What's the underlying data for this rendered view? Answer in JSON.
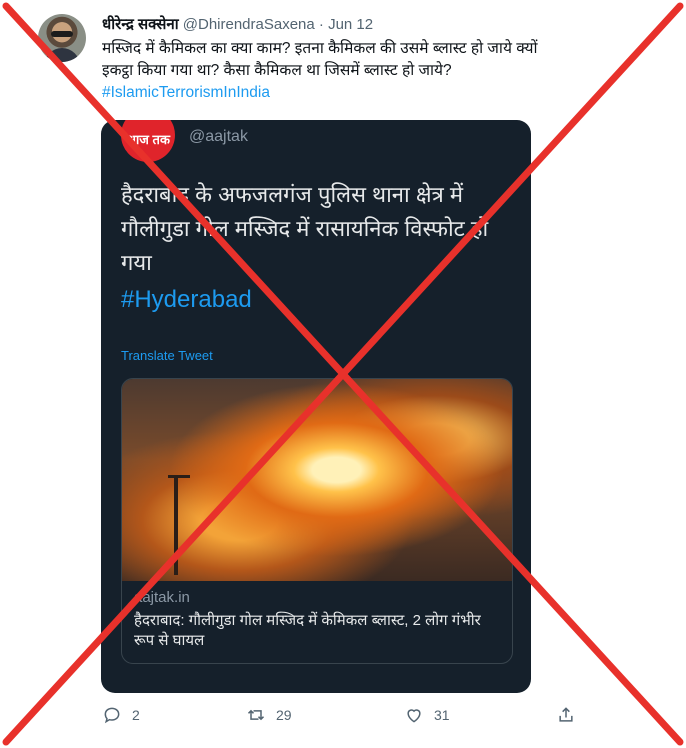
{
  "tweet": {
    "author_name": "धीरेन्द्र सक्सेना",
    "handle": "@DhirendraSaxena",
    "separator": "·",
    "date": "Jun 12",
    "text_line1": "मस्जिद में कैमिकल का क्या काम? इतना कैमिकल की उसमे ब्लास्ट हो जाये क्यों",
    "text_line2": "इकट्ठा किया गया था? कैसा कैमिकल था जिसमें ब्लास्ट हो जाये?",
    "hashtag": "#IslamicTerrorismInIndia"
  },
  "quoted": {
    "logo_text": "आज तक",
    "handle": "@aajtak",
    "text": "हैदराबाद के अफजलगंज पुलिस थाना क्षेत्र में गौलीगुडा गोल मस्जिद में रासायनिक विस्फोट हो गया",
    "hashtag": "#Hyderabad",
    "translate": "Translate Tweet",
    "link_domain": "aajtak.in",
    "link_title": "हैदराबाद: गौलीगुडा गोल मस्जिद में केमिकल ब्लास्ट, 2 लोग गंभीर रूप से घायल"
  },
  "actions": {
    "reply_count": "2",
    "retweet_count": "29",
    "like_count": "31"
  },
  "icons": [
    "reply-icon",
    "retweet-icon",
    "like-icon",
    "share-icon"
  ],
  "colors": {
    "hashtag": "#1d9bf0",
    "card_bg": "#15202b",
    "x_mark": "#e8312b"
  }
}
